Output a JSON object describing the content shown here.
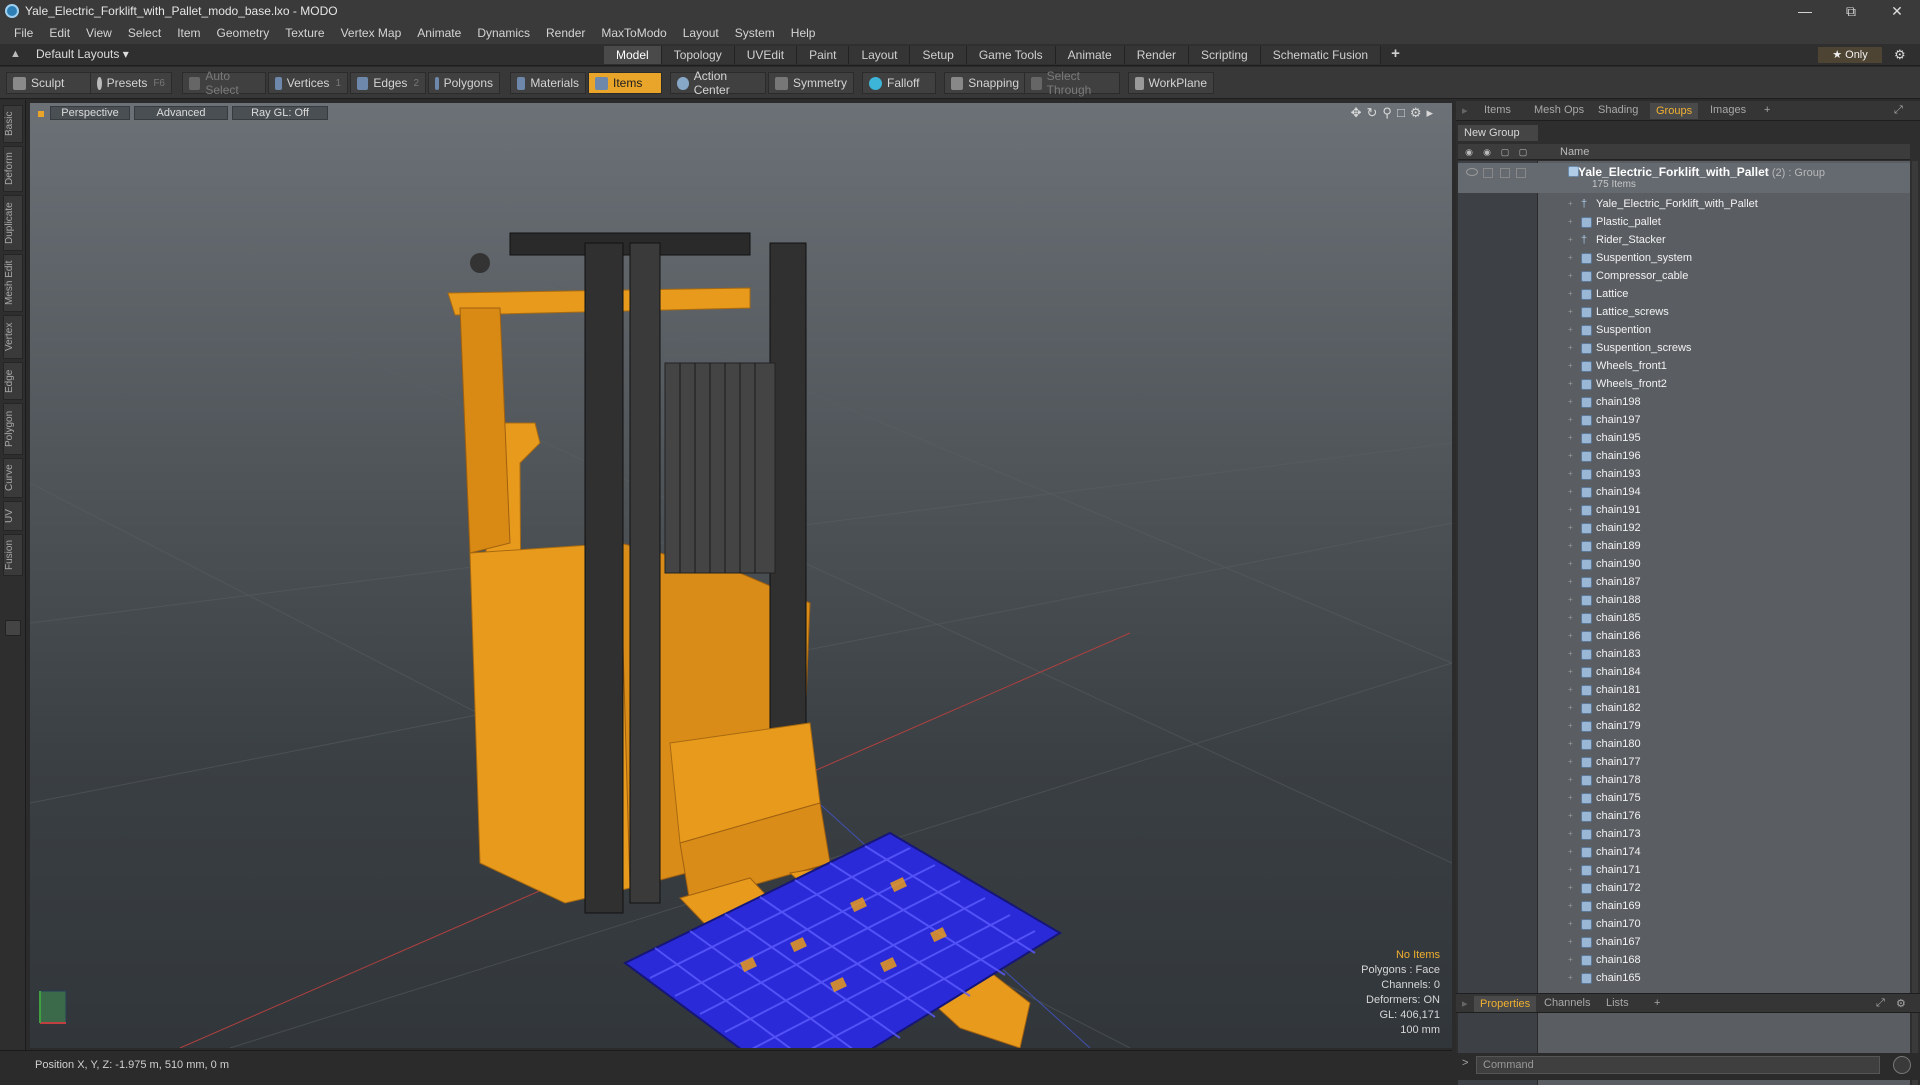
{
  "window": {
    "title": "Yale_Electric_Forklift_with_Pallet_modo_base.lxo - MODO"
  },
  "menu": [
    "File",
    "Edit",
    "View",
    "Select",
    "Item",
    "Geometry",
    "Texture",
    "Vertex Map",
    "Animate",
    "Dynamics",
    "Render",
    "MaxToModo",
    "Layout",
    "System",
    "Help"
  ],
  "layouts": {
    "label": "Default Layouts ▾"
  },
  "tabs": [
    {
      "label": "Model",
      "active": true
    },
    {
      "label": "Topology"
    },
    {
      "label": "UVEdit"
    },
    {
      "label": "Paint"
    },
    {
      "label": "Layout"
    },
    {
      "label": "Setup"
    },
    {
      "label": "Game Tools"
    },
    {
      "label": "Animate"
    },
    {
      "label": "Render"
    },
    {
      "label": "Scripting"
    },
    {
      "label": "Schematic Fusion"
    }
  ],
  "only_label": "★ Only",
  "toolbar": {
    "sculpt": "Sculpt",
    "presets": "Presets",
    "presets_key": "F6",
    "auto_select": "Auto Select",
    "vertices": "Vertices",
    "vertices_count": "1",
    "edges": "Edges",
    "edges_count": "2",
    "polygons": "Polygons",
    "materials": "Materials",
    "items": "Items",
    "action_center": "Action Center",
    "symmetry": "Symmetry",
    "falloff": "Falloff",
    "snapping": "Snapping",
    "select_through": "Select Through",
    "workplane": "WorkPlane"
  },
  "left_tabs": [
    "Basic",
    "Deform",
    "Duplicate",
    "Mesh Edit",
    "Vertex",
    "Edge",
    "Polygon",
    "Curve",
    "UV",
    "Fusion"
  ],
  "viewport": {
    "perspective": "Perspective",
    "advanced": "Advanced",
    "raygl": "Ray GL: Off",
    "stats": {
      "items": "No Items",
      "polygons": "Polygons : Face",
      "channels": "Channels: 0",
      "deformers": "Deformers: ON",
      "gl": "GL: 406,171",
      "scale": "100 mm"
    }
  },
  "status": {
    "position": "Position X, Y, Z:   -1.975 m, 510 mm, 0 m"
  },
  "right_tabs": [
    "Items",
    "Mesh Ops",
    "Shading",
    "Groups",
    "Images",
    "+"
  ],
  "new_group": "New Group",
  "list_header": {
    "name": "Name"
  },
  "group": {
    "name": "Yale_Electric_Forklift_with_Pallet",
    "suffix": " (2) : Group",
    "count": "175 Items"
  },
  "items": [
    {
      "label": "Yale_Electric_Forklift_with_Pallet",
      "icon": "locator-icon"
    },
    {
      "label": "Plastic_pallet",
      "icon": "mesh-icon"
    },
    {
      "label": "Rider_Stacker",
      "icon": "locator-icon"
    },
    {
      "label": "Suspention_system",
      "icon": "mesh-icon"
    },
    {
      "label": "Compressor_cable",
      "icon": "mesh-icon"
    },
    {
      "label": "Lattice",
      "icon": "mesh-icon"
    },
    {
      "label": "Lattice_screws",
      "icon": "mesh-icon"
    },
    {
      "label": "Suspention",
      "icon": "mesh-icon"
    },
    {
      "label": "Suspention_screws",
      "icon": "mesh-icon"
    },
    {
      "label": "Wheels_front1",
      "icon": "mesh-icon"
    },
    {
      "label": "Wheels_front2",
      "icon": "mesh-icon"
    },
    {
      "label": "chain198",
      "icon": "mesh-icon"
    },
    {
      "label": "chain197",
      "icon": "mesh-icon"
    },
    {
      "label": "chain195",
      "icon": "mesh-icon"
    },
    {
      "label": "chain196",
      "icon": "mesh-icon"
    },
    {
      "label": "chain193",
      "icon": "mesh-icon"
    },
    {
      "label": "chain194",
      "icon": "mesh-icon"
    },
    {
      "label": "chain191",
      "icon": "mesh-icon"
    },
    {
      "label": "chain192",
      "icon": "mesh-icon"
    },
    {
      "label": "chain189",
      "icon": "mesh-icon"
    },
    {
      "label": "chain190",
      "icon": "mesh-icon"
    },
    {
      "label": "chain187",
      "icon": "mesh-icon"
    },
    {
      "label": "chain188",
      "icon": "mesh-icon"
    },
    {
      "label": "chain185",
      "icon": "mesh-icon"
    },
    {
      "label": "chain186",
      "icon": "mesh-icon"
    },
    {
      "label": "chain183",
      "icon": "mesh-icon"
    },
    {
      "label": "chain184",
      "icon": "mesh-icon"
    },
    {
      "label": "chain181",
      "icon": "mesh-icon"
    },
    {
      "label": "chain182",
      "icon": "mesh-icon"
    },
    {
      "label": "chain179",
      "icon": "mesh-icon"
    },
    {
      "label": "chain180",
      "icon": "mesh-icon"
    },
    {
      "label": "chain177",
      "icon": "mesh-icon"
    },
    {
      "label": "chain178",
      "icon": "mesh-icon"
    },
    {
      "label": "chain175",
      "icon": "mesh-icon"
    },
    {
      "label": "chain176",
      "icon": "mesh-icon"
    },
    {
      "label": "chain173",
      "icon": "mesh-icon"
    },
    {
      "label": "chain174",
      "icon": "mesh-icon"
    },
    {
      "label": "chain171",
      "icon": "mesh-icon"
    },
    {
      "label": "chain172",
      "icon": "mesh-icon"
    },
    {
      "label": "chain169",
      "icon": "mesh-icon"
    },
    {
      "label": "chain170",
      "icon": "mesh-icon"
    },
    {
      "label": "chain167",
      "icon": "mesh-icon"
    },
    {
      "label": "chain168",
      "icon": "mesh-icon"
    },
    {
      "label": "chain165",
      "icon": "mesh-icon"
    }
  ],
  "bottom_tabs": [
    "Properties",
    "Channels",
    "Lists",
    "+"
  ],
  "command": {
    "placeholder": "Command",
    "prompt": ">"
  },
  "colors": {
    "accent": "#e8a52a",
    "forklift": "#e89a1c",
    "pallet": "#2a2ad8"
  }
}
